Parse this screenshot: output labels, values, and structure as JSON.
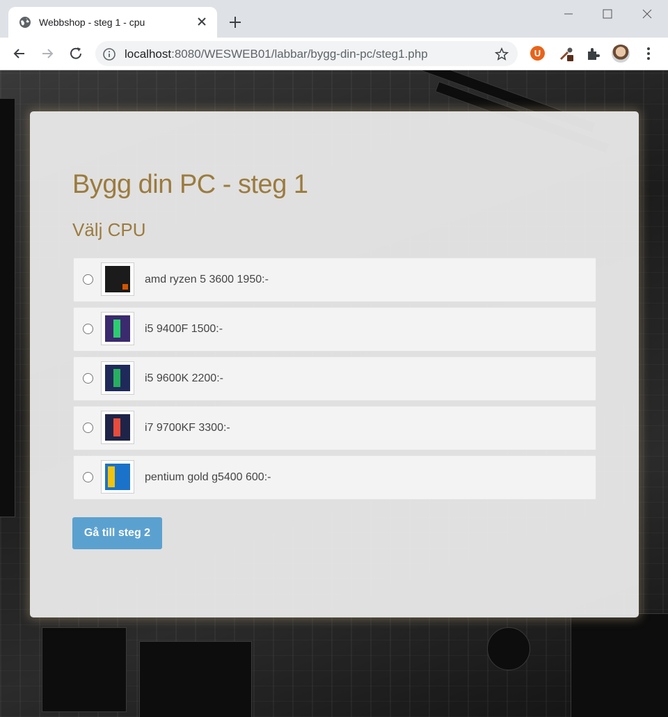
{
  "browser": {
    "tab_title": "Webbshop - steg 1 - cpu",
    "url_host": "localhost",
    "url_rest": ":8080/WESWEB01/labbar/bygg-din-pc/steg1.php",
    "extension_u": "U"
  },
  "page": {
    "heading": "Bygg din PC - steg 1",
    "subheading": "Välj CPU",
    "options": [
      {
        "label": "amd ryzen 5 3600 1950:-",
        "thumb_color": "#1b1b1b",
        "accent": "#d35400"
      },
      {
        "label": "i5 9400F 1500:-",
        "thumb_color": "#3b2a6e",
        "accent": "#2ecc71"
      },
      {
        "label": "i5 9600K 2200:-",
        "thumb_color": "#1f2a5a",
        "accent": "#27ae60"
      },
      {
        "label": "i7 9700KF 3300:-",
        "thumb_color": "#1e2447",
        "accent": "#e74c3c"
      },
      {
        "label": "pentium gold g5400 600:-",
        "thumb_color": "#1a73c8",
        "accent": "#f1c40f"
      }
    ],
    "submit_label": "Gå till steg 2"
  },
  "colors": {
    "heading": "#9b7b3e",
    "button": "#5ba1d0"
  }
}
